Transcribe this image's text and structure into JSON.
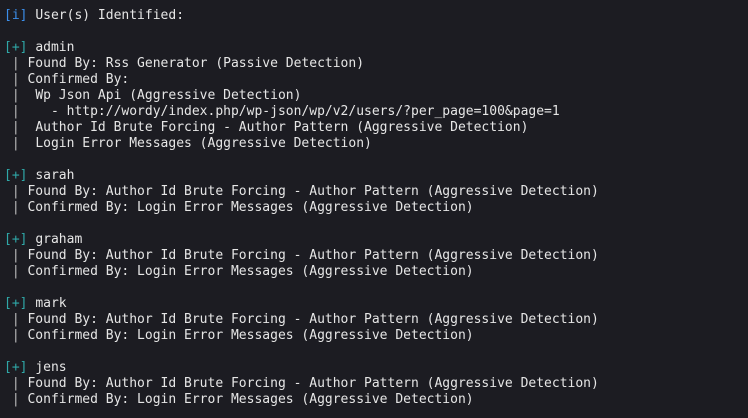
{
  "header": {
    "tag": "[i]",
    "title": "User(s) Identified:"
  },
  "users": [
    {
      "tag": "[+]",
      "name": "admin",
      "details": [
        {
          "prefix": " | ",
          "text": "Found By: Rss Generator (Passive Detection)"
        },
        {
          "prefix": " | ",
          "text": "Confirmed By:"
        },
        {
          "prefix": " |  ",
          "text": "Wp Json Api (Aggressive Detection)"
        },
        {
          "prefix": " |   ",
          "text": " - http://wordy/index.php/wp-json/wp/v2/users/?per_page=100&page=1"
        },
        {
          "prefix": " |  ",
          "text": "Author Id Brute Forcing - Author Pattern (Aggressive Detection)"
        },
        {
          "prefix": " |  ",
          "text": "Login Error Messages (Aggressive Detection)"
        }
      ]
    },
    {
      "tag": "[+]",
      "name": "sarah",
      "details": [
        {
          "prefix": " | ",
          "text": "Found By: Author Id Brute Forcing - Author Pattern (Aggressive Detection)"
        },
        {
          "prefix": " | ",
          "text": "Confirmed By: Login Error Messages (Aggressive Detection)"
        }
      ]
    },
    {
      "tag": "[+]",
      "name": "graham",
      "details": [
        {
          "prefix": " | ",
          "text": "Found By: Author Id Brute Forcing - Author Pattern (Aggressive Detection)"
        },
        {
          "prefix": " | ",
          "text": "Confirmed By: Login Error Messages (Aggressive Detection)"
        }
      ]
    },
    {
      "tag": "[+]",
      "name": "mark",
      "details": [
        {
          "prefix": " | ",
          "text": "Found By: Author Id Brute Forcing - Author Pattern (Aggressive Detection)"
        },
        {
          "prefix": " | ",
          "text": "Confirmed By: Login Error Messages (Aggressive Detection)"
        }
      ]
    },
    {
      "tag": "[+]",
      "name": "jens",
      "details": [
        {
          "prefix": " | ",
          "text": "Found By: Author Id Brute Forcing - Author Pattern (Aggressive Detection)"
        },
        {
          "prefix": " | ",
          "text": "Confirmed By: Login Error Messages (Aggressive Detection)"
        }
      ]
    }
  ],
  "colors": {
    "background": "#1c1c22",
    "info_tag": "#3b8eea",
    "plus_tag": "#2fa8a8",
    "text": "#e6e6e6"
  }
}
